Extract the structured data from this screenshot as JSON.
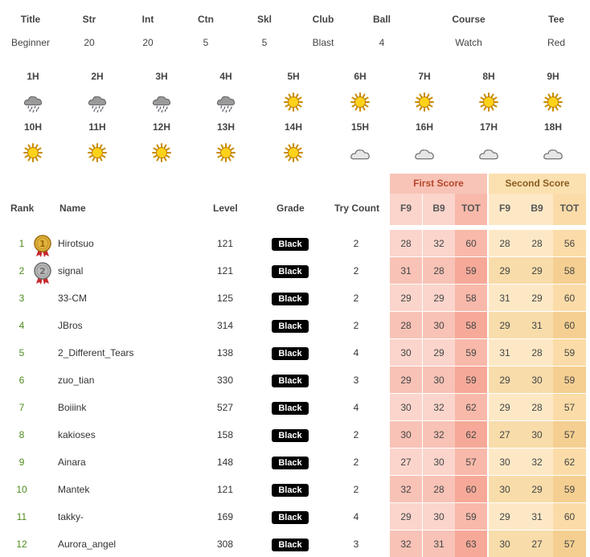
{
  "info": {
    "headers": [
      "Title",
      "Str",
      "Int",
      "Ctn",
      "Skl",
      "Club",
      "Ball",
      "Course",
      "Tee"
    ],
    "values": [
      "Beginner",
      "20",
      "20",
      "5",
      "5",
      "Blast",
      "4",
      "Watch",
      "Red"
    ]
  },
  "weather": {
    "row1": [
      {
        "hour": "1H",
        "icon": "rain-cloud-icon"
      },
      {
        "hour": "2H",
        "icon": "rain-cloud-icon"
      },
      {
        "hour": "3H",
        "icon": "rain-cloud-icon"
      },
      {
        "hour": "4H",
        "icon": "rain-cloud-icon"
      },
      {
        "hour": "5H",
        "icon": "sun-icon"
      },
      {
        "hour": "6H",
        "icon": "sun-icon"
      },
      {
        "hour": "7H",
        "icon": "sun-icon"
      },
      {
        "hour": "8H",
        "icon": "sun-icon"
      },
      {
        "hour": "9H",
        "icon": "sun-icon"
      }
    ],
    "row2": [
      {
        "hour": "10H",
        "icon": "sun-icon"
      },
      {
        "hour": "11H",
        "icon": "sun-icon"
      },
      {
        "hour": "12H",
        "icon": "sun-icon"
      },
      {
        "hour": "13H",
        "icon": "sun-icon"
      },
      {
        "hour": "14H",
        "icon": "sun-icon"
      },
      {
        "hour": "15H",
        "icon": "cloud-icon"
      },
      {
        "hour": "16H",
        "icon": "cloud-icon"
      },
      {
        "hour": "17H",
        "icon": "cloud-icon"
      },
      {
        "hour": "18H",
        "icon": "cloud-icon"
      }
    ]
  },
  "ranking": {
    "group_first": "First Score",
    "group_second": "Second Score",
    "columns": {
      "rank": "Rank",
      "name": "Name",
      "level": "Level",
      "grade": "Grade",
      "try": "Try Count",
      "f9": "F9",
      "b9": "B9",
      "tot": "TOT"
    },
    "rows": [
      {
        "rank": "1",
        "medal": "gold-medal-icon",
        "name": "Hirotsuo",
        "level": "121",
        "grade": "Black",
        "try": "2",
        "first": [
          "28",
          "32",
          "60"
        ],
        "second": [
          "28",
          "28",
          "56"
        ]
      },
      {
        "rank": "2",
        "medal": "silver-medal-icon",
        "name": "signal",
        "level": "121",
        "grade": "Black",
        "try": "2",
        "first": [
          "31",
          "28",
          "59"
        ],
        "second": [
          "29",
          "29",
          "58"
        ]
      },
      {
        "rank": "3",
        "medal": "",
        "name": "33-CM",
        "level": "125",
        "grade": "Black",
        "try": "2",
        "first": [
          "29",
          "29",
          "58"
        ],
        "second": [
          "31",
          "29",
          "60"
        ]
      },
      {
        "rank": "4",
        "medal": "",
        "name": "JBros",
        "level": "314",
        "grade": "Black",
        "try": "2",
        "first": [
          "28",
          "30",
          "58"
        ],
        "second": [
          "29",
          "31",
          "60"
        ]
      },
      {
        "rank": "5",
        "medal": "",
        "name": "2_Different_Tears",
        "level": "138",
        "grade": "Black",
        "try": "4",
        "first": [
          "30",
          "29",
          "59"
        ],
        "second": [
          "31",
          "28",
          "59"
        ]
      },
      {
        "rank": "6",
        "medal": "",
        "name": "zuo_tian",
        "level": "330",
        "grade": "Black",
        "try": "3",
        "first": [
          "29",
          "30",
          "59"
        ],
        "second": [
          "29",
          "30",
          "59"
        ]
      },
      {
        "rank": "7",
        "medal": "",
        "name": "Boiiink",
        "level": "527",
        "grade": "Black",
        "try": "4",
        "first": [
          "30",
          "32",
          "62"
        ],
        "second": [
          "29",
          "28",
          "57"
        ]
      },
      {
        "rank": "8",
        "medal": "",
        "name": "kakioses",
        "level": "158",
        "grade": "Black",
        "try": "2",
        "first": [
          "30",
          "32",
          "62"
        ],
        "second": [
          "27",
          "30",
          "57"
        ]
      },
      {
        "rank": "9",
        "medal": "",
        "name": "Ainara",
        "level": "148",
        "grade": "Black",
        "try": "2",
        "first": [
          "27",
          "30",
          "57"
        ],
        "second": [
          "30",
          "32",
          "62"
        ]
      },
      {
        "rank": "10",
        "medal": "",
        "name": "Mantek",
        "level": "121",
        "grade": "Black",
        "try": "2",
        "first": [
          "32",
          "28",
          "60"
        ],
        "second": [
          "30",
          "29",
          "59"
        ]
      },
      {
        "rank": "11",
        "medal": "",
        "name": "takky-",
        "level": "169",
        "grade": "Black",
        "try": "4",
        "first": [
          "29",
          "30",
          "59"
        ],
        "second": [
          "29",
          "31",
          "60"
        ]
      },
      {
        "rank": "12",
        "medal": "",
        "name": "Aurora_angel",
        "level": "308",
        "grade": "Black",
        "try": "3",
        "first": [
          "32",
          "31",
          "63"
        ],
        "second": [
          "30",
          "27",
          "57"
        ]
      }
    ]
  }
}
